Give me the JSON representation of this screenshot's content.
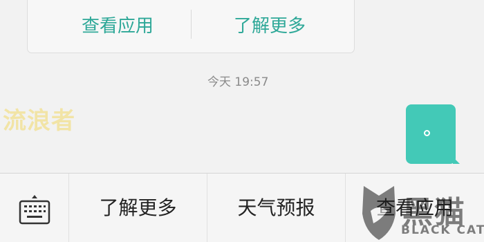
{
  "message_card": {
    "actions": [
      {
        "label": "查看应用"
      },
      {
        "label": "了解更多"
      }
    ]
  },
  "timestamp": "今天  19:57",
  "watermark_top": "流浪者",
  "sent_bubble": {
    "color": "#43c9b7",
    "content_icon": "circle-dot-icon"
  },
  "bottom_bar": {
    "keyboard_icon": "keyboard-icon",
    "menu": [
      {
        "label": "了解更多"
      },
      {
        "label": "天气预报"
      },
      {
        "label": "查看应用"
      }
    ]
  },
  "brand_watermark": {
    "cn": "黑猫",
    "en": "BLACK CAT"
  },
  "colors": {
    "accent_teal": "#2ea898",
    "bubble_teal": "#43c9b7",
    "background": "#f2f2f2",
    "watermark_yellow": "#f2e4a6"
  }
}
